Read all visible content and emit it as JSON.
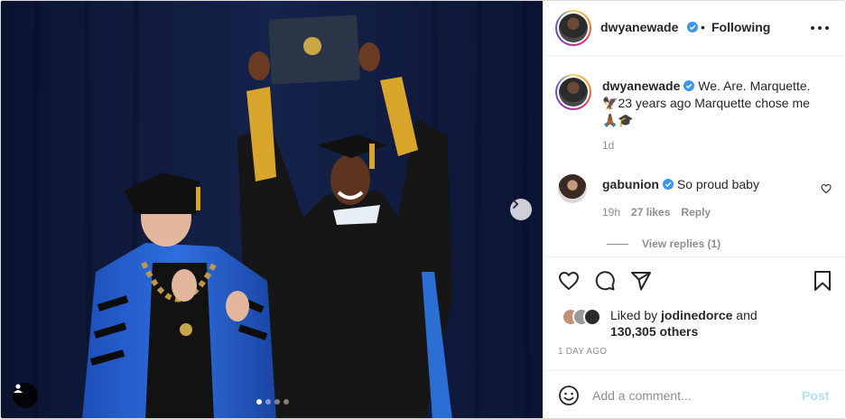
{
  "media": {
    "alt": "Graduation ceremony photo",
    "carousel_total": 4,
    "carousel_active": 1
  },
  "header": {
    "username": "dwyanewade",
    "separator": "•",
    "follow_status": "Following"
  },
  "caption": {
    "username": "dwyanewade",
    "text_line1": "We. Are. Marquette.",
    "text_line2": "23 years ago Marquette chose me",
    "age": "1d"
  },
  "comments": [
    {
      "username": "gabunion",
      "text": "So proud baby",
      "age": "19h",
      "likes": "27 likes",
      "reply_label": "Reply"
    }
  ],
  "view_replies": "View replies (1)",
  "likes": {
    "prefix": "Liked by",
    "user": "jodinedorce",
    "and": "and",
    "others": "130,305 others"
  },
  "timestamp": "1 day ago",
  "add_comment": {
    "placeholder": "Add a comment...",
    "post_label": "Post"
  },
  "colors": {
    "verified": "#3897f0",
    "post_disabled": "#b2dffc",
    "meta_gray": "#8e8e8e"
  },
  "icons": [
    "more-options-icon",
    "heart-icon",
    "comment-icon",
    "share-icon",
    "bookmark-icon",
    "emoji-icon",
    "verified-badge-icon",
    "chevron-right-icon",
    "user-tag-icon"
  ]
}
